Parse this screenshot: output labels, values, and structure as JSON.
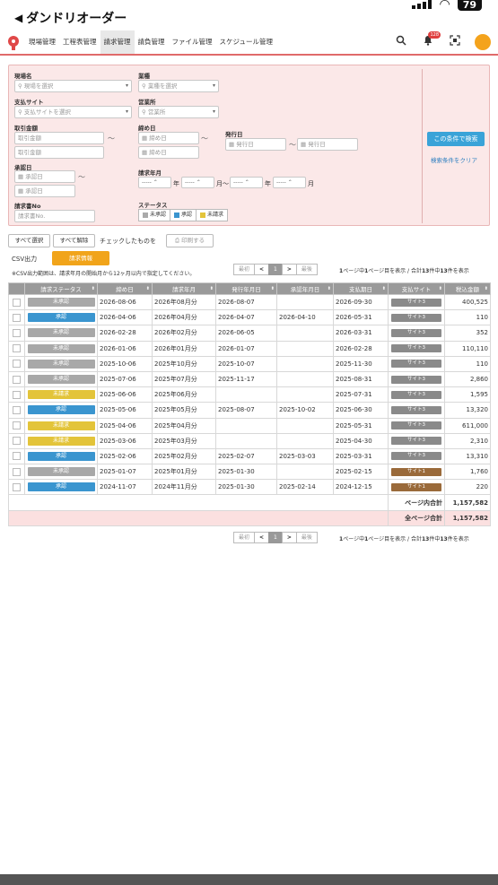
{
  "status_bar": {
    "battery": "79"
  },
  "header": {
    "back_label": "ダンドリオーダー"
  },
  "nav": {
    "items": [
      "現場管理",
      "工程表管理",
      "請求管理",
      "請負管理",
      "ファイル管理",
      "スケジュール管理"
    ],
    "active_index": 2,
    "notification_count": "128"
  },
  "filters": {
    "site_label": "現場名",
    "site_placeholder": "現場を選択",
    "trade_label": "業種",
    "trade_placeholder": "業種を選択",
    "pay_site_label": "支払サイト",
    "pay_site_placeholder": "支払サイトを選択",
    "office_label": "営業所",
    "office_placeholder": "営業所",
    "amount_label": "取引金額",
    "amount_placeholder_from": "取引金額",
    "amount_placeholder_to": "取引金額",
    "closing_label": "締め日",
    "closing_placeholder_from": "締め日",
    "closing_placeholder_to": "締め日",
    "issue_label": "発行日",
    "issue_placeholder_from": "発行日",
    "issue_placeholder_to": "発行日",
    "approval_label": "承認日",
    "approval_placeholder_from": "承認日",
    "approval_placeholder_to": "承認日",
    "billing_month_label": "請求年月",
    "year_unit": "年",
    "month_unit": "月",
    "range_sep": "～",
    "select_blank": "-----",
    "invoice_no_label": "請求書No",
    "invoice_no_placeholder": "請求書No.",
    "status_label": "ステータス",
    "status_chips": [
      {
        "label": "未承認",
        "color": "#aaaaaa"
      },
      {
        "label": "承認",
        "color": "#3a95cf"
      },
      {
        "label": "未請求",
        "color": "#e3c43a"
      }
    ],
    "search_button": "この条件で検索",
    "clear_link": "検索条件をクリア"
  },
  "actions": {
    "select_all": "すべて選択",
    "deselect_all": "すべて解除",
    "checked_text": "チェックしたものを",
    "print": "印刷する",
    "csv_label": "CSV出力",
    "csv_button": "請求情報",
    "csv_note": "※CSV出力範囲は、請求年月の開始月から12ヶ月以内で指定してください。"
  },
  "pager": {
    "first": "最初",
    "prev": "<",
    "current": "1",
    "next": ">",
    "last": "最後",
    "info_parts": [
      "1",
      "ページ中",
      "1",
      "ページ目を表示 / 合計",
      "13",
      "件中",
      "13",
      "件を表示"
    ]
  },
  "table": {
    "headers": [
      "請求ステータス",
      "締め日",
      "請求年月",
      "発行年月日",
      "承認年月日",
      "支払期日",
      "支払サイト",
      "税込金額"
    ],
    "rows": [
      {
        "status": "未承認",
        "closing": "2026-08-06",
        "month": "2026年08月分",
        "issued": "2026-08-07",
        "approved": "",
        "due": "2026-09-30",
        "site": "サイト3",
        "amount": "400,525"
      },
      {
        "status": "承認",
        "closing": "2026-04-06",
        "month": "2026年04月分",
        "issued": "2026-04-07",
        "approved": "2026-04-10",
        "due": "2026-05-31",
        "site": "サイト3",
        "amount": "110"
      },
      {
        "status": "未承認",
        "closing": "2026-02-28",
        "month": "2026年02月分",
        "issued": "2026-06-05",
        "approved": "",
        "due": "2026-03-31",
        "site": "サイト3",
        "amount": "352"
      },
      {
        "status": "未承認",
        "closing": "2026-01-06",
        "month": "2026年01月分",
        "issued": "2026-01-07",
        "approved": "",
        "due": "2026-02-28",
        "site": "サイト3",
        "amount": "110,110"
      },
      {
        "status": "未承認",
        "closing": "2025-10-06",
        "month": "2025年10月分",
        "issued": "2025-10-07",
        "approved": "",
        "due": "2025-11-30",
        "site": "サイト3",
        "amount": "110"
      },
      {
        "status": "未承認",
        "closing": "2025-07-06",
        "month": "2025年07月分",
        "issued": "2025-11-17",
        "approved": "",
        "due": "2025-08-31",
        "site": "サイト3",
        "amount": "2,860"
      },
      {
        "status": "未請求",
        "closing": "2025-06-06",
        "month": "2025年06月分",
        "issued": "",
        "approved": "",
        "due": "2025-07-31",
        "site": "サイト3",
        "amount": "1,595"
      },
      {
        "status": "承認",
        "closing": "2025-05-06",
        "month": "2025年05月分",
        "issued": "2025-08-07",
        "approved": "2025-10-02",
        "due": "2025-06-30",
        "site": "サイト3",
        "amount": "13,320"
      },
      {
        "status": "未請求",
        "closing": "2025-04-06",
        "month": "2025年04月分",
        "issued": "",
        "approved": "",
        "due": "2025-05-31",
        "site": "サイト3",
        "amount": "611,000"
      },
      {
        "status": "未請求",
        "closing": "2025-03-06",
        "month": "2025年03月分",
        "issued": "",
        "approved": "",
        "due": "2025-04-30",
        "site": "サイト3",
        "amount": "2,310"
      },
      {
        "status": "承認",
        "closing": "2025-02-06",
        "month": "2025年02月分",
        "issued": "2025-02-07",
        "approved": "2025-03-03",
        "due": "2025-03-31",
        "site": "サイト3",
        "amount": "13,310"
      },
      {
        "status": "未承認",
        "closing": "2025-01-07",
        "month": "2025年01月分",
        "issued": "2025-01-30",
        "approved": "",
        "due": "2025-02-15",
        "site": "サイト1",
        "amount": "1,760"
      },
      {
        "status": "承認",
        "closing": "2024-11-07",
        "month": "2024年11月分",
        "issued": "2025-01-30",
        "approved": "2025-02-14",
        "due": "2024-12-15",
        "site": "サイト1",
        "amount": "220"
      }
    ],
    "page_total_label": "ページ内合計",
    "page_total": "1,157,582",
    "grand_total_label": "全ページ合計",
    "grand_total": "1,157,582"
  },
  "colors": {
    "status": {
      "未承認": "#a8a8a8",
      "承認": "#3a95cf",
      "未請求": "#e3c43a"
    },
    "site": {
      "サイト3": "#8a8a8a",
      "サイト1": "#9a6a3a"
    },
    "accent": "#e06a6a"
  }
}
